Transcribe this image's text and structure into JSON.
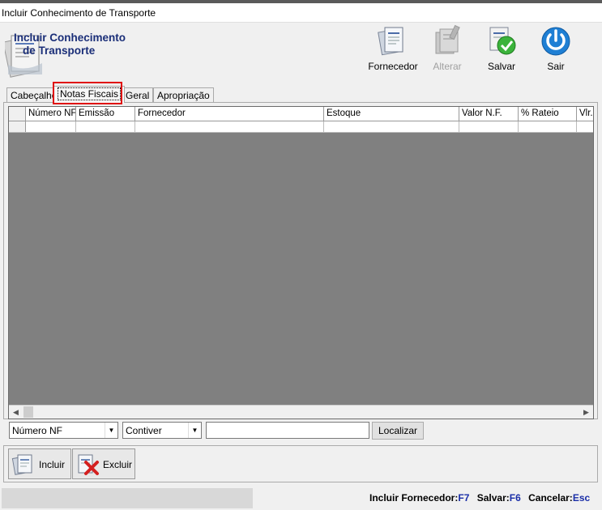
{
  "window": {
    "title": "Incluir Conhecimento de Transporte"
  },
  "header": {
    "title_line1": "Incluir Conhecimento",
    "title_line2": "de Transporte",
    "title_color": "#1a2e78"
  },
  "toolbar": [
    {
      "label": "Fornecedor",
      "icon": "documents-icon",
      "enabled": true
    },
    {
      "label": "Alterar",
      "icon": "edit-documents-icon",
      "enabled": false
    },
    {
      "label": "Salvar",
      "icon": "save-check-icon",
      "enabled": true
    },
    {
      "label": "Sair",
      "icon": "power-icon",
      "enabled": true
    }
  ],
  "tabs": [
    {
      "label": "Cabeçalho",
      "active": false
    },
    {
      "label": "Notas Fiscais",
      "active": true
    },
    {
      "label": "Geral",
      "active": false
    },
    {
      "label": "Apropriação",
      "active": false
    }
  ],
  "grid": {
    "columns": [
      "Número NF",
      "Emissão",
      "Fornecedor",
      "Estoque",
      "Valor N.F.",
      "% Rateio",
      "Vlr."
    ],
    "rows": [
      [
        "",
        "",
        "",
        "",
        "",
        "",
        ""
      ]
    ]
  },
  "filter": {
    "field_select": "Número NF",
    "operator_select": "Contiver",
    "search_value": "",
    "search_button": "Localizar"
  },
  "actions": {
    "add_label": "Incluir",
    "delete_label": "Excluir"
  },
  "shortcuts": [
    {
      "label": "Incluir Fornecedor:",
      "key": "F7"
    },
    {
      "label": "Salvar:",
      "key": "F6"
    },
    {
      "label": "Cancelar:",
      "key": "Esc"
    }
  ],
  "colors": {
    "grid_bg": "#808080",
    "shortcut_key": "#1a2ea8",
    "highlight": "#e01010"
  }
}
